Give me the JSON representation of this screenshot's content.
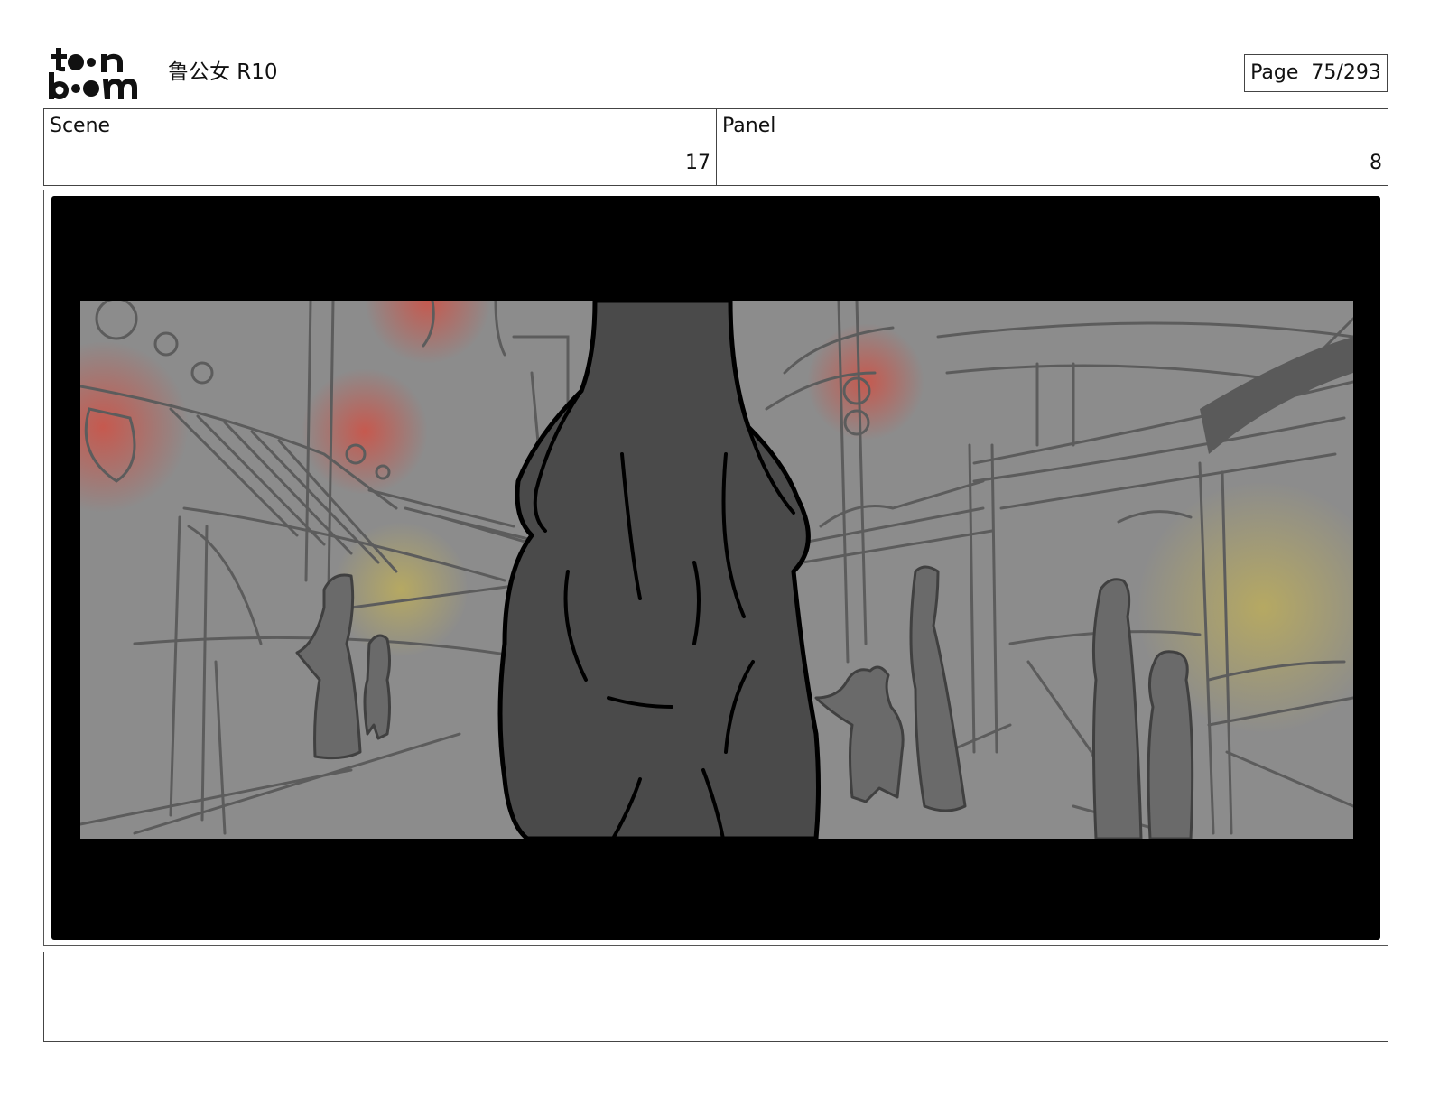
{
  "header": {
    "logo_text": "toon boom",
    "title": "鲁公女 R10",
    "page_label": "Page",
    "page_number": "75/293"
  },
  "scene": {
    "label": "Scene",
    "value": "17"
  },
  "panel": {
    "label": "Panel",
    "value": "8"
  },
  "notes": {
    "text": ""
  },
  "colors": {
    "frame_background": "#000000",
    "sketch_background": "#8c8c8c",
    "sketch_lines": "#555555",
    "silhouette_dark": "#4a4a4a",
    "silhouette_mid": "#6a6a6a",
    "lantern_glow_red": "#d9483a",
    "lantern_glow_yellow": "#d8c040"
  }
}
